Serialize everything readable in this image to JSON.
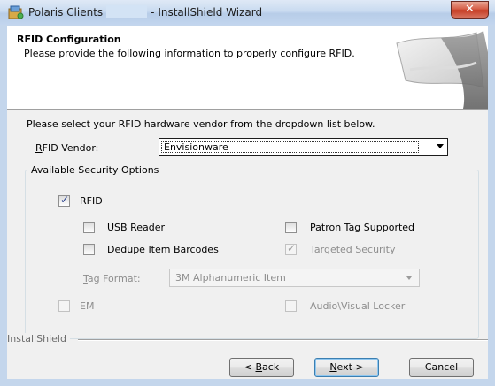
{
  "window": {
    "title_left": "Polaris Clients",
    "title_right": "- InstallShield Wizard",
    "close_glyph": "✕"
  },
  "header": {
    "title": "RFID Configuration",
    "subtitle": "Please provide the following information to properly configure RFID."
  },
  "instruction": "Please select your RFID hardware vendor from the dropdown list below.",
  "vendor": {
    "label_prefix": "R",
    "label_rest": "FID Vendor:",
    "value": "Envisionware"
  },
  "security": {
    "group_label": "Available Security Options",
    "rfid": {
      "label": "RFID",
      "checked": true
    },
    "usb_reader": {
      "label": "USB Reader",
      "checked": false
    },
    "patron_tag": {
      "label": "Patron Tag Supported",
      "checked": false
    },
    "dedupe": {
      "label": "Dedupe Item Barcodes",
      "checked": false
    },
    "targeted": {
      "label": "Targeted Security",
      "checked": true,
      "disabled": true
    },
    "tag_format": {
      "label_prefix": "T",
      "label_rest": "ag Format:",
      "value": "3M Alphanumeric Item"
    },
    "em": {
      "label": "EM",
      "checked": false,
      "disabled": true
    },
    "av_locker": {
      "label": "Audio\\Visual Locker",
      "checked": false,
      "disabled": true
    }
  },
  "footer": {
    "brand": "InstallShield",
    "back_prefix": "< ",
    "back_ul": "B",
    "back_rest": "ack",
    "next_ul": "N",
    "next_rest": "ext >",
    "cancel": "Cancel"
  },
  "icons": {
    "app": "installer-icon",
    "check": "✓"
  },
  "colors": {
    "frame": "#c4d6ec",
    "close": "#c63d25",
    "dialog": "#f0f0f0",
    "check": "#1f3a8a"
  }
}
